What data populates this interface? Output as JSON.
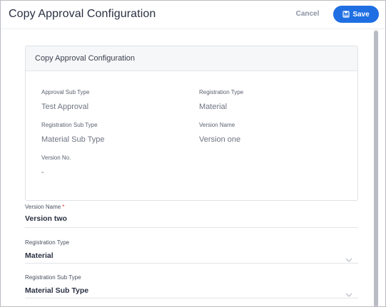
{
  "header": {
    "title": "Copy Approval Configuration",
    "cancel_label": "Cancel",
    "save_label": "Save"
  },
  "card": {
    "title": "Copy Approval Configuration",
    "approval_sub_type": {
      "label": "Approval Sub Type",
      "value": "Test Approval"
    },
    "registration_type": {
      "label": "Registration Type",
      "value": "Material"
    },
    "registration_sub_type": {
      "label": "Registration Sub Type",
      "value": "Material Sub Type"
    },
    "version_name": {
      "label": "Version Name",
      "value": "Version one"
    },
    "version_no": {
      "label": "Version No.",
      "value": "-"
    }
  },
  "form": {
    "version_name": {
      "label": "Version Name",
      "required_mark": "*",
      "value": "Version two"
    },
    "registration_type": {
      "label": "Registration Type",
      "value": "Material"
    },
    "registration_sub_type": {
      "label": "Registration Sub Type",
      "value": "Material Sub Type"
    }
  },
  "colors": {
    "accent": "#1f6fe3",
    "required": "#e0342f"
  }
}
